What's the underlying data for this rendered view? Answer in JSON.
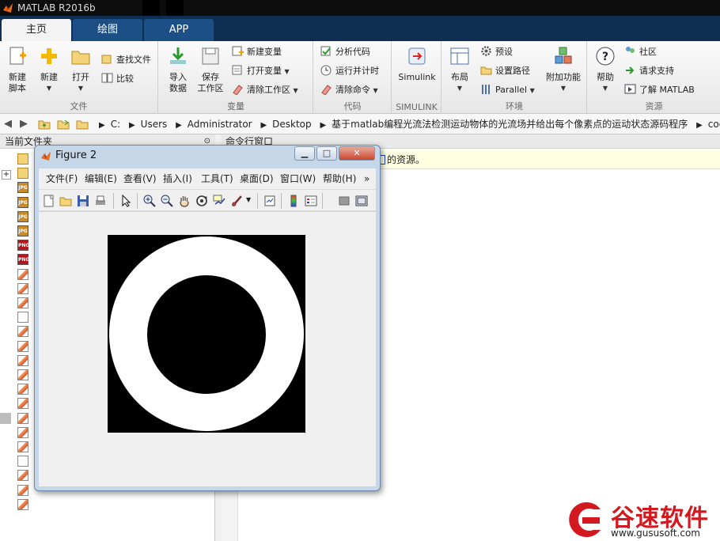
{
  "app": {
    "title": "MATLAB R2016b",
    "window_controls": [
      "minimize",
      "maximize",
      "close"
    ]
  },
  "tabs": [
    {
      "label": "主页",
      "active": true
    },
    {
      "label": "绘图",
      "active": false
    },
    {
      "label": "APP",
      "active": false
    }
  ],
  "ribbon": {
    "file": {
      "label": "文件",
      "new_script": [
        "新建",
        "脚本"
      ],
      "new": "新建",
      "open": "打开",
      "find_files": "查找文件",
      "compare": "比较"
    },
    "variable": {
      "label": "变量",
      "import": [
        "导入",
        "数据"
      ],
      "save": [
        "保存",
        "工作区"
      ],
      "new_var": "新建变量",
      "open_var": "打开变量",
      "clear_ws": "清除工作区"
    },
    "code": {
      "label": "代码",
      "analyze": "分析代码",
      "run_time": "运行并计时",
      "clear_cmd": "清除命令"
    },
    "simulink": {
      "label": "SIMULINK",
      "button": "Simulink"
    },
    "env": {
      "label": "环境",
      "layout": "布局",
      "prefs": "预设",
      "set_path": "设置路径",
      "parallel": "Parallel",
      "addons": "附加功能"
    },
    "resources": {
      "label": "资源",
      "help": "帮助",
      "community": "社区",
      "support": "请求支持",
      "learn": "了解 MATLAB"
    }
  },
  "address": {
    "crumbs": [
      "C:",
      "Users",
      "Administrator",
      "Desktop",
      "基于matlab编程光流法检测运动物体的光流场并给出每个像素点的运动状态源码程序",
      "code"
    ]
  },
  "current_folder": {
    "label": "当前文件夹"
  },
  "command_window": {
    "label": "命令行窗口",
    "note_text": "的资源。"
  },
  "figure": {
    "title": "Figure 2",
    "menu": [
      "文件(F)",
      "编辑(E)",
      "查看(V)",
      "插入(I)",
      "工具(T)",
      "桌面(D)",
      "窗口(W)",
      "帮助(H)"
    ],
    "menu_more": "»",
    "toolbar_icons": [
      "new-figure-icon",
      "open-file-icon",
      "save-icon",
      "print-icon",
      "pointer-icon",
      "zoom-in-icon",
      "zoom-out-icon",
      "pan-hand-icon",
      "rotate-3d-icon",
      "data-cursor-icon",
      "brush-icon",
      "link-plot-icon",
      "colorbar-icon",
      "legend-icon",
      "hide-plot-tools-icon",
      "show-plot-tools-icon"
    ]
  },
  "file_list": [
    {
      "type": "folder"
    },
    {
      "type": "folder"
    },
    {
      "type": "jpg",
      "badge": "JPG"
    },
    {
      "type": "jpg",
      "badge": "JPG"
    },
    {
      "type": "jpg",
      "badge": "JPG"
    },
    {
      "type": "jpg",
      "badge": "JPG"
    },
    {
      "type": "png",
      "badge": "PNG"
    },
    {
      "type": "png",
      "badge": "PNG"
    },
    {
      "type": "m"
    },
    {
      "type": "m"
    },
    {
      "type": "m"
    },
    {
      "type": "txt"
    },
    {
      "type": "m"
    },
    {
      "type": "m"
    },
    {
      "type": "m"
    },
    {
      "type": "m"
    },
    {
      "type": "m"
    },
    {
      "type": "m"
    },
    {
      "type": "m"
    },
    {
      "type": "m"
    },
    {
      "type": "m"
    },
    {
      "type": "txt"
    },
    {
      "type": "m"
    },
    {
      "type": "m"
    },
    {
      "type": "m"
    }
  ],
  "watermark": {
    "brand": "谷速软件",
    "url": "www.gususoft.com",
    "color": "#d4181f"
  }
}
